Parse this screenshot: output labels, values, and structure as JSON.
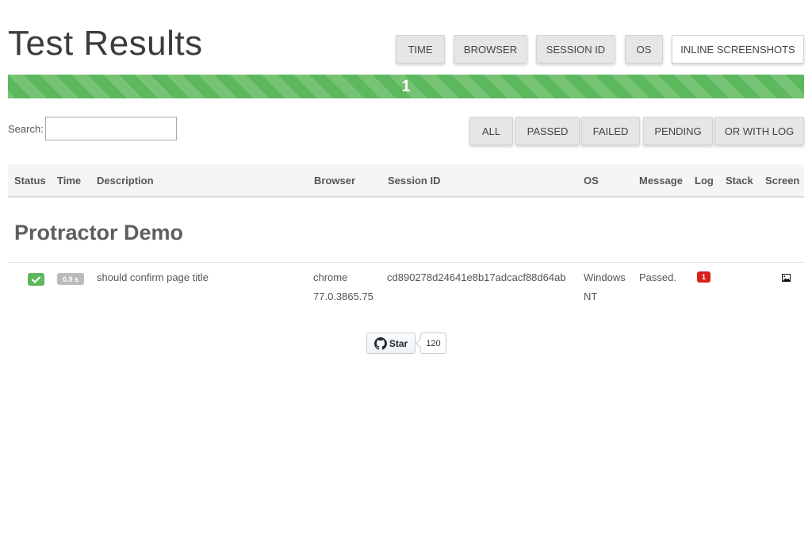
{
  "page": {
    "title": "Test Results"
  },
  "column_toggles": [
    {
      "label": "TIME",
      "active": false
    },
    {
      "label": "BROWSER",
      "active": false
    },
    {
      "label": "SESSION ID",
      "active": false
    },
    {
      "label": "OS",
      "active": false
    },
    {
      "label": "INLINE SCREENSHOTS",
      "active": true
    }
  ],
  "progress": {
    "label": "1",
    "passed_fraction": 1.0,
    "color": "#5cb85c"
  },
  "search": {
    "label": "Search:",
    "value": ""
  },
  "filters": [
    {
      "label": "ALL"
    },
    {
      "label": "PASSED"
    },
    {
      "label": "FAILED"
    },
    {
      "label": "PENDING"
    },
    {
      "label": "OR WITH LOG"
    }
  ],
  "table": {
    "headers": [
      "Status",
      "Time",
      "Description",
      "Browser",
      "Session ID",
      "OS",
      "Message",
      "Log",
      "Stack",
      "Screen"
    ],
    "group": "Protractor Demo",
    "rows": [
      {
        "status": "passed",
        "status_icon": "check-icon",
        "time": "0.9 s",
        "description": "should confirm page title",
        "browser_name": "chrome",
        "browser_version": "77.0.3865.75",
        "session_id": "cd890278d24641e8b17adcacf88d64ab",
        "os_line1": "Windows",
        "os_line2": "NT",
        "message": "Passed.",
        "log_count": "1",
        "stack": "",
        "screen_icon": "image-icon"
      }
    ]
  },
  "github": {
    "star_label": "Star",
    "star_count": "120",
    "icon": "github-icon"
  },
  "colors": {
    "success": "#5cb85c",
    "danger": "#d9201f",
    "muted_badge": "#bbbbbb"
  }
}
